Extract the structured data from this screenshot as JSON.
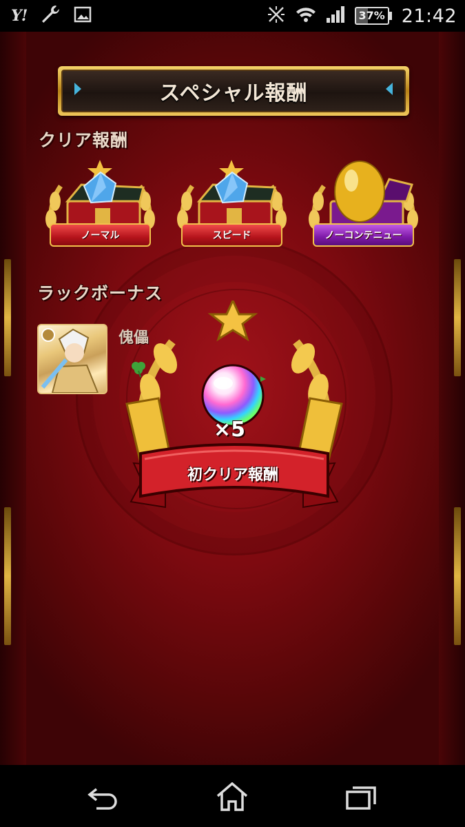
{
  "status_bar": {
    "yahoo_label": "Y!",
    "battery_percent": "37%",
    "time": "21:42",
    "icons": [
      "wrench-icon",
      "image-icon",
      "vibrate-off-icon",
      "wifi-icon",
      "signal-icon",
      "battery-icon"
    ]
  },
  "game": {
    "title": "スペシャル報酬",
    "clear_rewards": {
      "heading": "クリア報酬",
      "items": [
        {
          "label": "ノーマル",
          "reward": "crystal-chest",
          "ribbon_color": "#c0141c"
        },
        {
          "label": "スピード",
          "reward": "crystal-chest",
          "ribbon_color": "#c0141c"
        },
        {
          "label": "ノーコンテニュー",
          "reward": "golden-egg-chest",
          "ribbon_color": "#8a22b8"
        }
      ]
    },
    "luck_bonus": {
      "heading": "ラックボーナス",
      "monster_name": "傀儡"
    },
    "first_clear": {
      "count": "×5",
      "label": "初クリア報酬",
      "reward": "rainbow-orb"
    }
  },
  "nav_bar": {
    "buttons": [
      "back-icon",
      "home-icon",
      "recent-apps-icon"
    ]
  },
  "colors": {
    "background": "#7e0a10",
    "gold": "#e2b543",
    "plaque_dark": "#1d1410"
  }
}
